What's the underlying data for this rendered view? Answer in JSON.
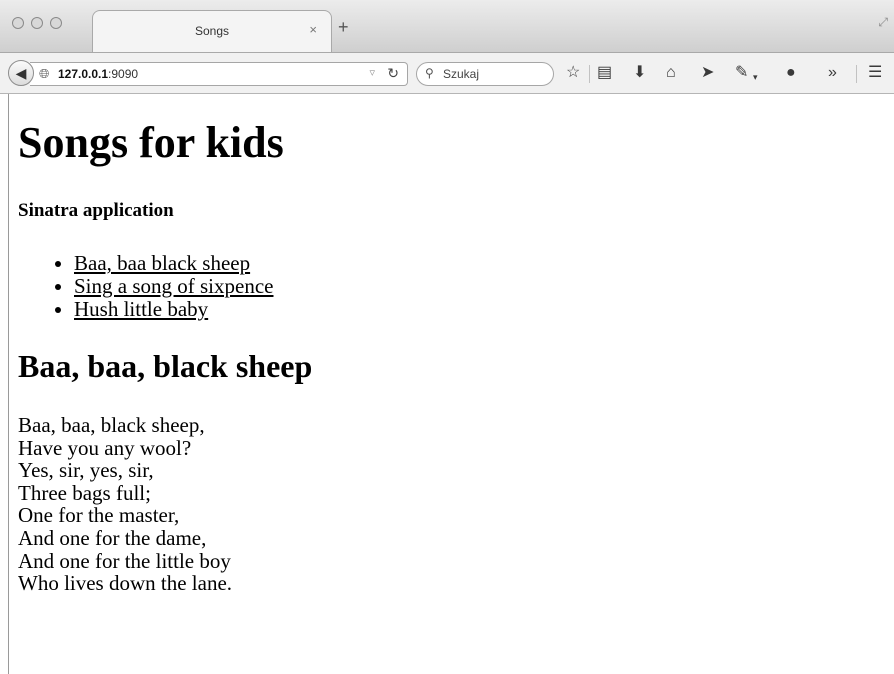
{
  "browser": {
    "tab_title": "Songs",
    "tab_close": "×",
    "new_tab": "+",
    "url_host": "127.0.0.1",
    "url_port": ":9090",
    "search_placeholder": "Szukaj",
    "icons": [
      "back-icon",
      "globe-icon",
      "reload-icon",
      "search-icon",
      "bookmark-star-icon",
      "reading-list-icon",
      "download-icon",
      "home-icon",
      "share-icon",
      "pocket-icon",
      "chat-icon",
      "overflow-icon",
      "menu-icon"
    ]
  },
  "page": {
    "title": "Songs for kids",
    "subtitle": "Sinatra application",
    "songs": [
      {
        "label": "Baa, baa black sheep"
      },
      {
        "label": "Sing a song of sixpence"
      },
      {
        "label": "Hush little baby"
      }
    ],
    "current_song": {
      "title": "Baa, baa, black sheep",
      "lines": [
        "Baa, baa, black sheep,",
        "Have you any wool?",
        "Yes, sir, yes, sir,",
        "Three bags full;",
        "One for the master,",
        "And one for the dame,",
        "And one for the little boy",
        "Who lives down the lane."
      ]
    }
  }
}
